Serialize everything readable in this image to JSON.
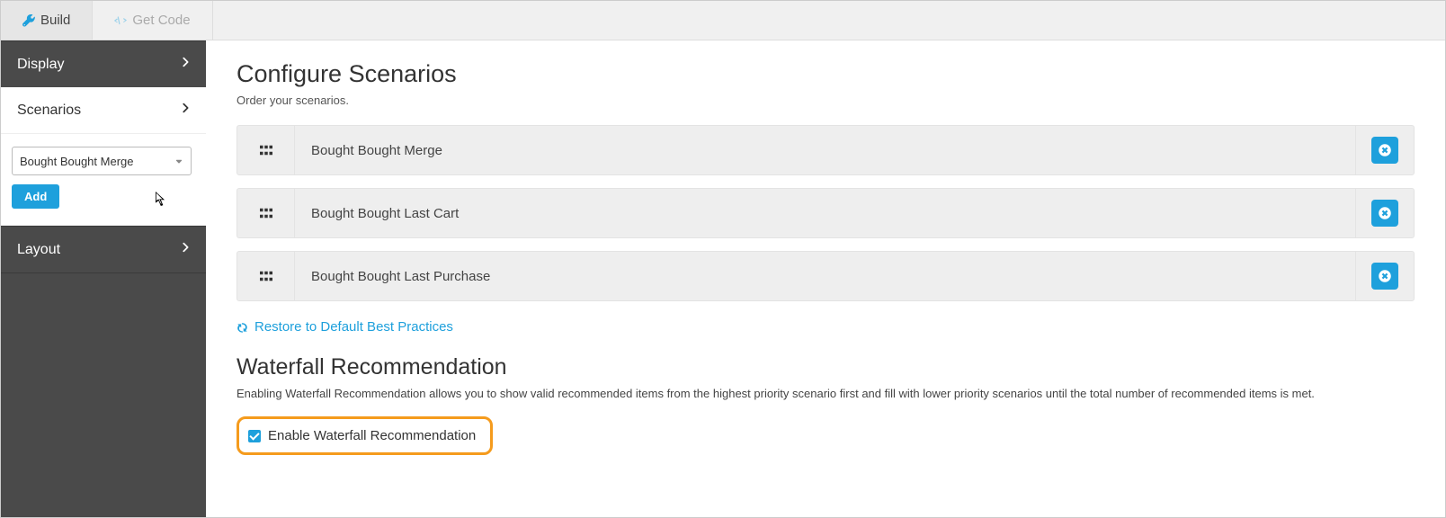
{
  "tabs": {
    "build": "Build",
    "getcode": "Get Code"
  },
  "sidebar": {
    "display": "Display",
    "scenarios": "Scenarios",
    "layout": "Layout",
    "select_value": "Bought Bought Merge",
    "add_label": "Add"
  },
  "main": {
    "title": "Configure Scenarios",
    "subtitle": "Order your scenarios.",
    "scenarios": [
      {
        "label": "Bought Bought Merge"
      },
      {
        "label": "Bought Bought Last Cart"
      },
      {
        "label": "Bought Bought Last Purchase"
      }
    ],
    "restore_label": "Restore to Default Best Practices",
    "waterfall_title": "Waterfall Recommendation",
    "waterfall_desc": "Enabling Waterfall Recommendation allows you to show valid recommended items from the highest priority scenario first and fill with lower priority scenarios until the total number of recommended items is met.",
    "checkbox_label": "Enable Waterfall Recommendation"
  }
}
